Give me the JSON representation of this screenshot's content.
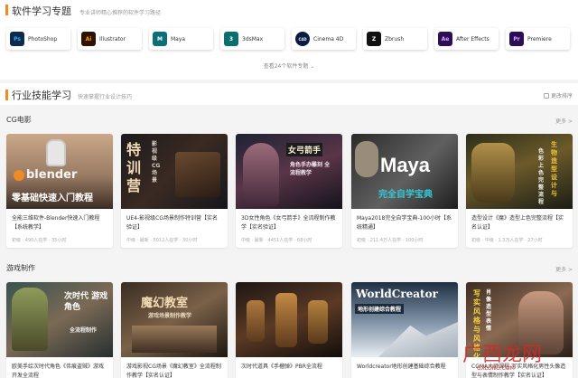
{
  "software_section": {
    "title": "软件学习专题",
    "subtitle": "专业讲师精心推荐的软件学习路径",
    "more_label": "查看24个软件专题",
    "items": [
      {
        "label": "PhotoShop",
        "icon": "Ps",
        "icon_name": "photoshop-icon",
        "color": "#0c2a4a",
        "fg": "#31a8ff"
      },
      {
        "label": "Illustrator",
        "icon": "Ai",
        "icon_name": "illustrator-icon",
        "color": "#2e1400",
        "fg": "#ff9a00"
      },
      {
        "label": "Maya",
        "icon": "M",
        "icon_name": "maya-icon",
        "color": "#0a6f78",
        "fg": "#ffffff"
      },
      {
        "label": "3dsMax",
        "icon": "3",
        "icon_name": "3dsmax-icon",
        "color": "#0b6f6f",
        "fg": "#ffffff"
      },
      {
        "label": "Cinema 4D",
        "icon": "C4D",
        "icon_name": "cinema4d-icon",
        "color": "#0a1a45",
        "fg": "#ffffff"
      },
      {
        "label": "Zbrush",
        "icon": "Z",
        "icon_name": "zbrush-icon",
        "color": "#111111",
        "fg": "#ffffff"
      },
      {
        "label": "After Effects",
        "icon": "Ae",
        "icon_name": "aftereffects-icon",
        "color": "#2a0f56",
        "fg": "#d8a3ff"
      },
      {
        "label": "Premiere",
        "icon": "Pr",
        "icon_name": "premiere-icon",
        "color": "#2a0f56",
        "fg": "#e0a3ff"
      }
    ]
  },
  "industry_section": {
    "title": "行业技能学习",
    "subtitle": "快速掌握行业设计技巧",
    "sort_label": "更改排序"
  },
  "categories": [
    {
      "title": "CG电影",
      "more": "更多 >",
      "courses": [
        {
          "title": "全能三维软件-Blender快速入门教程【系统教学】",
          "meta": "初级 · 490人在学 · 35小时",
          "thumb_text": "零基础快速入门教程",
          "logo_text": "blender"
        },
        {
          "title": "UE4-影视级CG场景制作特训营【实名验证】",
          "meta": "中级 · 最新 · 5012人在学 · 30小时",
          "thumb_text": "特训营",
          "logo_text": "影视级CG场景"
        },
        {
          "title": "3D女性角色《女弓箭手》全流程制作教学【实名验证】",
          "meta": "中级 · 最新 · 4451人在学 · 68小时",
          "thumb_text": "女弓箭手",
          "logo_text": "角色手办雕刻 全流程教学"
        },
        {
          "title": "Maya2018完全自学宝典-100小时【系统精通】",
          "meta": "初级 · 211.4万人在学 · 100小时",
          "thumb_text": "Maya",
          "logo_text": "完全自学宝典"
        },
        {
          "title": "造型设计《魔》造型上色完整流程【实名认证】",
          "meta": "初级 · 中级 · 1.3万人在学 · 27小时",
          "thumb_text": "生物造型设计与",
          "logo_text": "色彩上色完整流程"
        }
      ]
    },
    {
      "title": "游戏制作",
      "more": "更多 >",
      "courses": [
        {
          "title": "欧美手绘次时代角色《伟痕盗贼》游戏开发全流程",
          "meta": "",
          "thumb_text": "次时代 游戏角色",
          "logo_text": "全流程制作"
        },
        {
          "title": "游戏影视CG场景《魔幻教室》全流程制作教学【实名认证】",
          "meta": "",
          "thumb_text": "魔幻教室",
          "logo_text": "游戏场景制作教学"
        },
        {
          "title": "次时代道具《手榴弹》PBR全流程",
          "meta": "",
          "thumb_text": "",
          "logo_text": ""
        },
        {
          "title": "Worldcreator地形创建基础综合教程",
          "meta": "",
          "thumb_text": "WorldCreator",
          "logo_text": "地形创建综合教程"
        },
        {
          "title": "CGMA大师课程-写实风格化男性头像造型与表情制作教学【实名认证】",
          "meta": "",
          "thumb_text": "写实风格与风格化",
          "logo_text": "肖像造型表情"
        }
      ]
    }
  ],
  "watermark": {
    "text": "广西龙网",
    "sub": "GXLONG.COM"
  }
}
